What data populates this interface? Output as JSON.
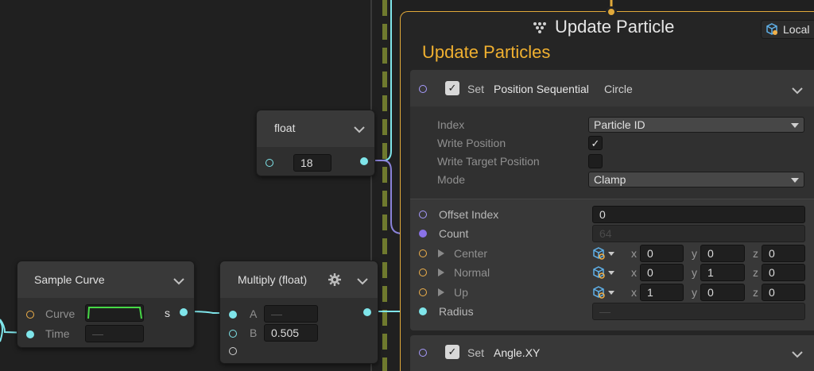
{
  "float_node": {
    "title": "float",
    "value": "18"
  },
  "sample_curve": {
    "title": "Sample Curve",
    "curve_label": "Curve",
    "time_label": "Time",
    "time_value": "—",
    "output_label": "s"
  },
  "multiply": {
    "title": "Multiply (float)",
    "a_label": "A",
    "a_value": "—",
    "b_label": "B",
    "b_value": "0.505"
  },
  "context": {
    "title": "Update Particle",
    "subtitle": "Update Particles",
    "space_label": "Local"
  },
  "block_position": {
    "set_label": "Set",
    "name": "Position Sequential",
    "variant": "Circle",
    "index_label": "Index",
    "index_value": "Particle ID",
    "write_position_label": "Write Position",
    "write_target_label": "Write Target Position",
    "mode_label": "Mode",
    "mode_value": "Clamp",
    "offset_index_label": "Offset Index",
    "offset_index_value": "0",
    "count_label": "Count",
    "count_value": "64",
    "center_label": "Center",
    "center": {
      "x": "0",
      "y": "0",
      "z": "0"
    },
    "normal_label": "Normal",
    "normal": {
      "x": "0",
      "y": "1",
      "z": "0"
    },
    "up_label": "Up",
    "up": {
      "x": "1",
      "y": "0",
      "z": "0"
    },
    "radius_label": "Radius",
    "radius_value": "—"
  },
  "block_angle": {
    "set_label": "Set",
    "name": "Angle.XY"
  },
  "axis_labels": {
    "x": "x",
    "y": "y",
    "z": "z"
  },
  "colors": {
    "context_border": "#e1a93a",
    "float_port": "#7fe5ea",
    "vector_port": "#f0b04a",
    "particle_id_port": "#8a72e8"
  }
}
